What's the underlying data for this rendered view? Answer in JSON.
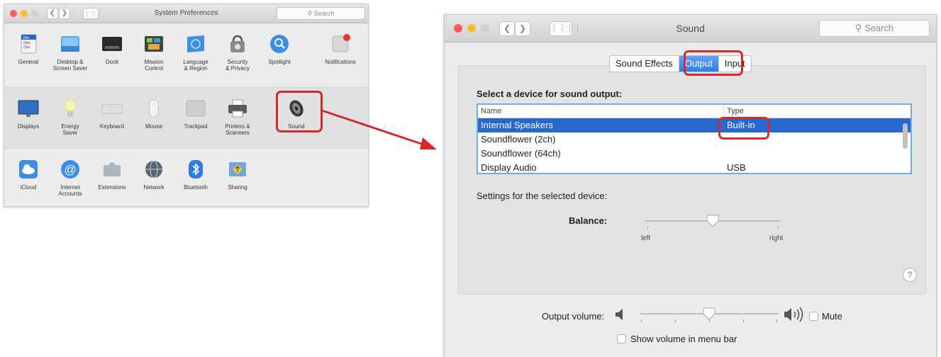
{
  "sysprefs": {
    "title": "System Preferences",
    "search_placeholder": "Search",
    "row1": [
      {
        "label1": "General",
        "label2": ""
      },
      {
        "label1": "Desktop &",
        "label2": "Screen Saver"
      },
      {
        "label1": "Dock",
        "label2": ""
      },
      {
        "label1": "Mission",
        "label2": "Control"
      },
      {
        "label1": "Language",
        "label2": "& Region"
      },
      {
        "label1": "Security",
        "label2": "& Privacy"
      },
      {
        "label1": "Spotlight",
        "label2": ""
      },
      {
        "label1": "Notifications",
        "label2": ""
      }
    ],
    "row2": [
      {
        "label1": "Displays",
        "label2": ""
      },
      {
        "label1": "Energy",
        "label2": "Saver"
      },
      {
        "label1": "Keyboard",
        "label2": ""
      },
      {
        "label1": "Mouse",
        "label2": ""
      },
      {
        "label1": "Trackpad",
        "label2": ""
      },
      {
        "label1": "Printers &",
        "label2": "Scanners"
      },
      {
        "label1": "Sound",
        "label2": ""
      }
    ],
    "row3": [
      {
        "label1": "iCloud",
        "label2": ""
      },
      {
        "label1": "Internet",
        "label2": "Accounts"
      },
      {
        "label1": "Extensions",
        "label2": ""
      },
      {
        "label1": "Network",
        "label2": ""
      },
      {
        "label1": "Bluetooth",
        "label2": ""
      },
      {
        "label1": "Sharing",
        "label2": ""
      }
    ],
    "general_icon_text": [
      "File",
      "New",
      "Ope"
    ]
  },
  "sound": {
    "title": "Sound",
    "search_placeholder": "Search",
    "tabs": [
      "Sound Effects",
      "Output",
      "Input"
    ],
    "active_tab": "Output",
    "device_heading": "Select a device for sound output:",
    "columns": [
      "Name",
      "Type"
    ],
    "devices": [
      {
        "name": "Internal Speakers",
        "type": "Built-in"
      },
      {
        "name": "Soundflower (2ch)",
        "type": ""
      },
      {
        "name": "Soundflower (64ch)",
        "type": ""
      },
      {
        "name": "Display Audio",
        "type": "USB"
      }
    ],
    "settings_heading": "Settings for the selected device:",
    "balance_label": "Balance:",
    "balance_left": "left",
    "balance_right": "right",
    "balance_value": 0.5,
    "help": "?",
    "output_volume_label": "Output volume:",
    "volume_value": 0.5,
    "mute_label": "Mute",
    "menu_bar_label": "Show volume in menu bar"
  },
  "colors": {
    "highlight_red": "#d42a2a",
    "selection_blue": "#2468d0",
    "arrow_red": "#d42a2a"
  }
}
